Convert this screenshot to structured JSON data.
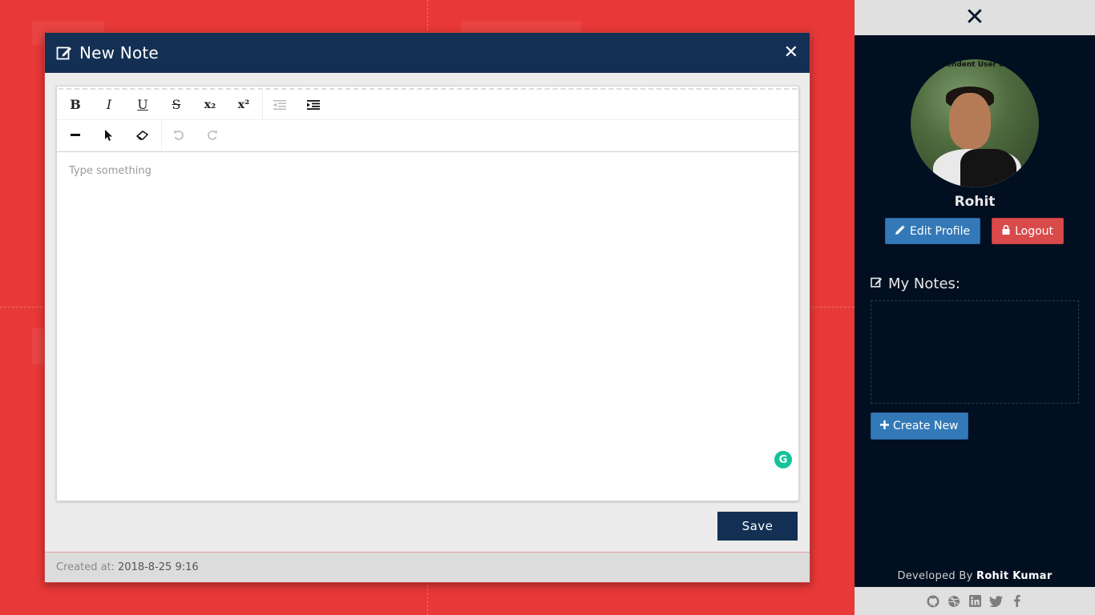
{
  "modal": {
    "title": "New Note",
    "close_glyph": "✕",
    "editor_placeholder": "Type something",
    "save_label": "Save",
    "created_label": "Created at:",
    "created_value": "2018-8-25 9:16",
    "toolbar_row1": [
      "bold-icon",
      "italic-icon",
      "underline-icon",
      "strikethrough-icon",
      "subscript-icon",
      "superscript-icon",
      "outdent-icon",
      "indent-icon"
    ],
    "toolbar_row2": [
      "horizontal-rule-icon",
      "pointer-icon",
      "eraser-icon",
      "undo-icon",
      "redo-icon"
    ],
    "toolbar_labels": {
      "bold": "B",
      "italic": "I",
      "underline": "U",
      "strike": "S",
      "sub": "x₂",
      "sup": "x²"
    }
  },
  "sidebar": {
    "close_glyph": "✕",
    "avatar_banner": "pendent User co",
    "user_name": "Rohit",
    "edit_profile_label": "Edit Profile",
    "logout_label": "Logout",
    "notes_heading": "My Notes:",
    "create_new_label": "Create New",
    "developed_by_label": "Developed By",
    "developer_name": "Rohit Kumar",
    "social_icons": [
      "github-icon",
      "dribbble-icon",
      "linkedin-icon",
      "twitter-icon",
      "facebook-icon"
    ]
  },
  "colors": {
    "background": "#e83838",
    "modal_header": "#133054",
    "sidebar": "#010f21",
    "primary_button": "#3479b7",
    "danger_button": "#d94b4b",
    "grammarly": "#15c39a"
  }
}
